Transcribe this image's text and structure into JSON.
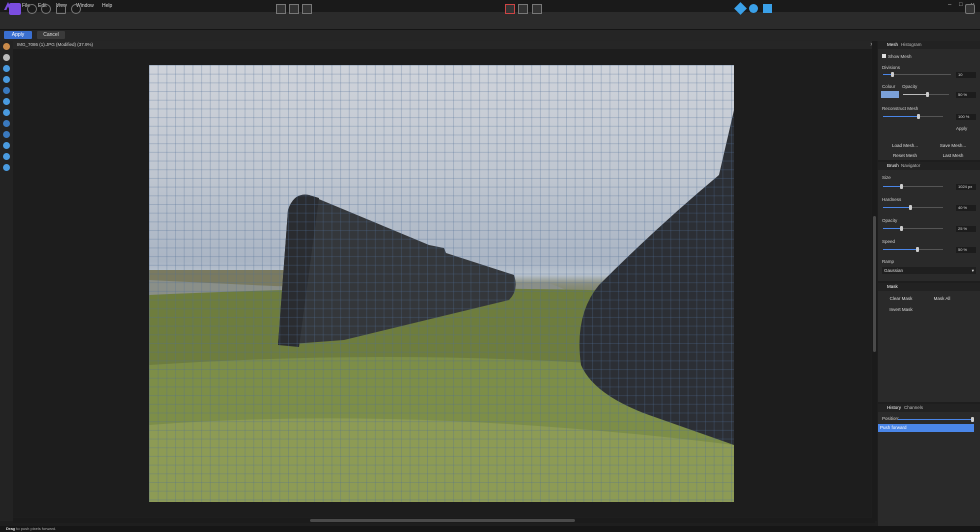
{
  "menubar": {
    "items": [
      "File",
      "Edit",
      "View",
      "Window",
      "Help"
    ],
    "window_controls": [
      "–",
      "□",
      "✕"
    ]
  },
  "context": {
    "apply_label": "Apply",
    "cancel_label": "Cancel"
  },
  "document": {
    "title": "IMG_7086 (1).JPG (Modified) (37.9%)",
    "close": "✕"
  },
  "mesh_panel": {
    "tabs": [
      "Mesh",
      "Histogram"
    ],
    "show_mesh_label": "Show Mesh",
    "divisions_label": "Divisions",
    "divisions_value": "10",
    "color_label": "Colour",
    "opacity_label": "Opacity",
    "opacity_value": "50 %",
    "reconstruct_label": "Reconstruct Mesh",
    "reconstruct_value": "100 %",
    "apply_label": "Apply",
    "load_mesh": "Load Mesh...",
    "save_mesh": "Save Mesh...",
    "reset_mesh": "Reset Mesh",
    "last_mesh": "Last Mesh"
  },
  "brush_panel": {
    "tabs": [
      "Brush",
      "Navigator"
    ],
    "size_label": "Size",
    "size_value": "1024 px",
    "size_level": 0.3,
    "hardness_label": "Hardness",
    "hardness_value": "40 %",
    "opacity_label": "Opacity",
    "opacity_value": "25 %",
    "speed_label": "Speed",
    "speed_value": "50 %",
    "ramp_label": "Ramp",
    "ramp_value": "Gaussian"
  },
  "mask_panel": {
    "tab": "Mask",
    "clear_mask": "Clear Mask",
    "mask_all": "Mask All",
    "invert_mask": "Invert Mask"
  },
  "history_panel": {
    "tabs": [
      "History",
      "Channels"
    ],
    "position_label": "Position:",
    "selected_entry": "Push forward"
  },
  "status": {
    "bold": "Drag",
    "text": "to push pixels forward."
  },
  "colors": {
    "accent": "#4a86e8",
    "persona": "#7b4de0",
    "mesh_color": "#7aa0d8"
  }
}
